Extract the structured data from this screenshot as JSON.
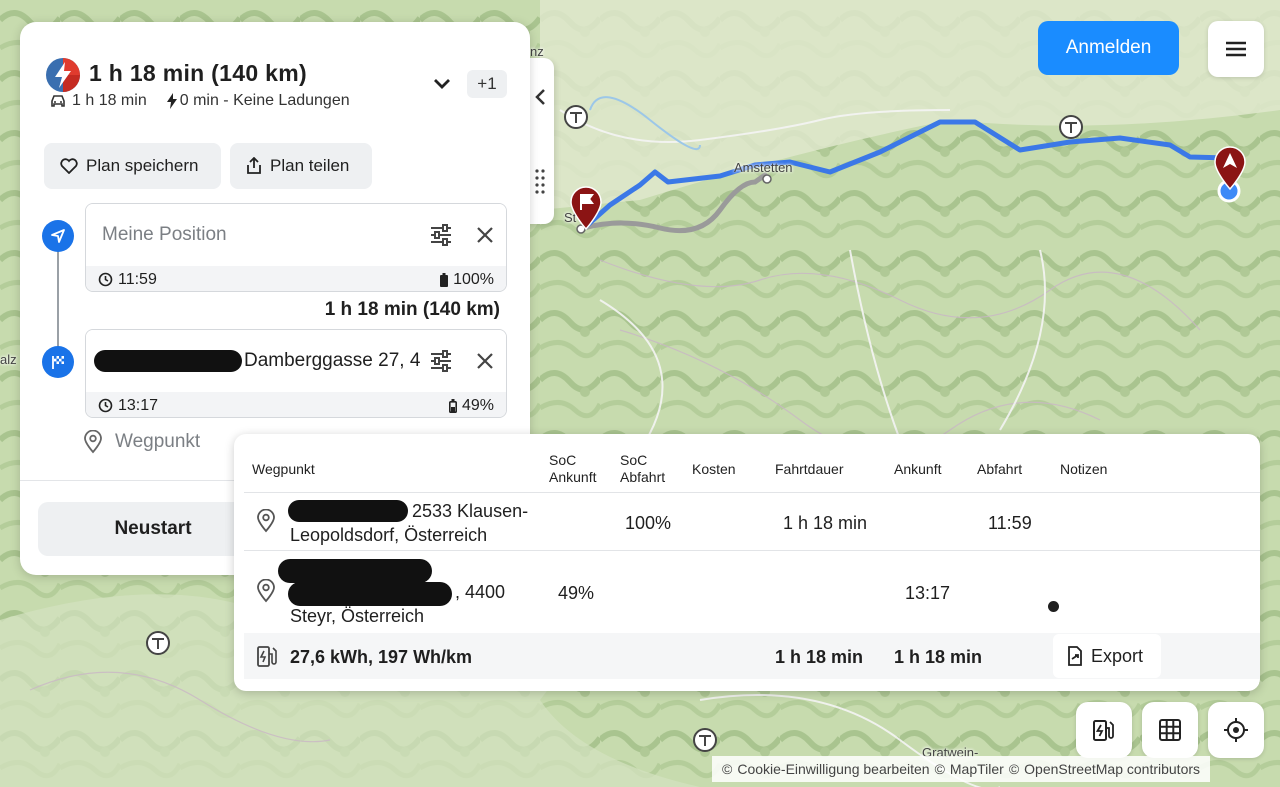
{
  "summary": {
    "title": "1 h 18 min (140 km)",
    "drive_time": "1 h 18 min",
    "charge_info": "0 min - Keine Ladungen",
    "alternatives_badge": "+1"
  },
  "actions": {
    "save_plan": "Plan speichern",
    "share_plan": "Plan teilen",
    "restart": "Neustart",
    "login": "Anmelden"
  },
  "stops": [
    {
      "placeholder": "Meine Position",
      "time": "11:59",
      "battery": "100%"
    },
    {
      "value": "Damberggasse 27, 4",
      "time": "13:17",
      "battery": "49%"
    }
  ],
  "leg_summary": "1 h 18 min (140 km)",
  "waypoint_placeholder": "Wegpunkt",
  "map": {
    "place_label": "Amstetten",
    "place_label_2": "Gratwein-",
    "edge_label_left": "alz",
    "edge_label_top": "nz",
    "edge_label_stop": "St"
  },
  "table": {
    "headers": {
      "wegpunkt": "Wegpunkt",
      "soc_arrival_1": "SoC",
      "soc_arrival_2": "Ankunft",
      "soc_departure_1": "SoC",
      "soc_departure_2": "Abfahrt",
      "kosten": "Kosten",
      "fahrtdauer": "Fahrtdauer",
      "ankunft": "Ankunft",
      "abfahrt": "Abfahrt",
      "notizen": "Notizen"
    },
    "rows": [
      {
        "addr1": "2533 Klausen-",
        "addr2": "Leopoldsdorf, Österreich",
        "soc_departure": "100%",
        "duration": "1 h 18 min",
        "departure": "11:59"
      },
      {
        "addr1": ", 4400",
        "addr2": "Steyr, Österreich",
        "soc_arrival": "49%",
        "arrival": "13:17"
      }
    ],
    "footer": {
      "energy": "27,6 kWh, 197 Wh/km",
      "total_duration": "1 h 18 min",
      "total_arrival": "1 h 18 min",
      "export": "Export"
    }
  },
  "attribution": {
    "cookie": "Cookie-Einwilligung bearbeiten",
    "maptiler": "MapTiler",
    "osm": "OpenStreetMap contributors"
  },
  "colors": {
    "accent": "#1a8cff",
    "route_main": "#3b78e7",
    "route_alt": "#9a9a9a",
    "marker": "#8b1414"
  }
}
